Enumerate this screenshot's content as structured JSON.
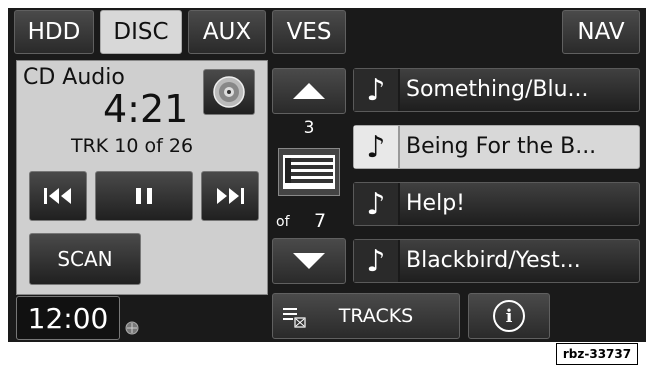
{
  "tabs": [
    {
      "label": "HDD"
    },
    {
      "label": "DISC"
    },
    {
      "label": "AUX"
    },
    {
      "label": "VES"
    }
  ],
  "nav_label": "NAV",
  "source_title": "CD Audio",
  "elapsed_time": "4:21",
  "track_status": "TRK 10 of 26",
  "scan_label": "SCAN",
  "clock": "12:00",
  "page_current": "3",
  "page_of_label": "of",
  "page_total": "7",
  "tracks": [
    {
      "name": "Something/Blu..."
    },
    {
      "name": "Being For the B..."
    },
    {
      "name": "Help!"
    },
    {
      "name": "Blackbird/Yest..."
    }
  ],
  "tracks_label": "TRACKS",
  "info_label": "i",
  "caption_code": "rbz-33737",
  "colors": {
    "active": "#d8d8d8",
    "panel": "#cfcfcf",
    "background": "#1a1a1a"
  }
}
